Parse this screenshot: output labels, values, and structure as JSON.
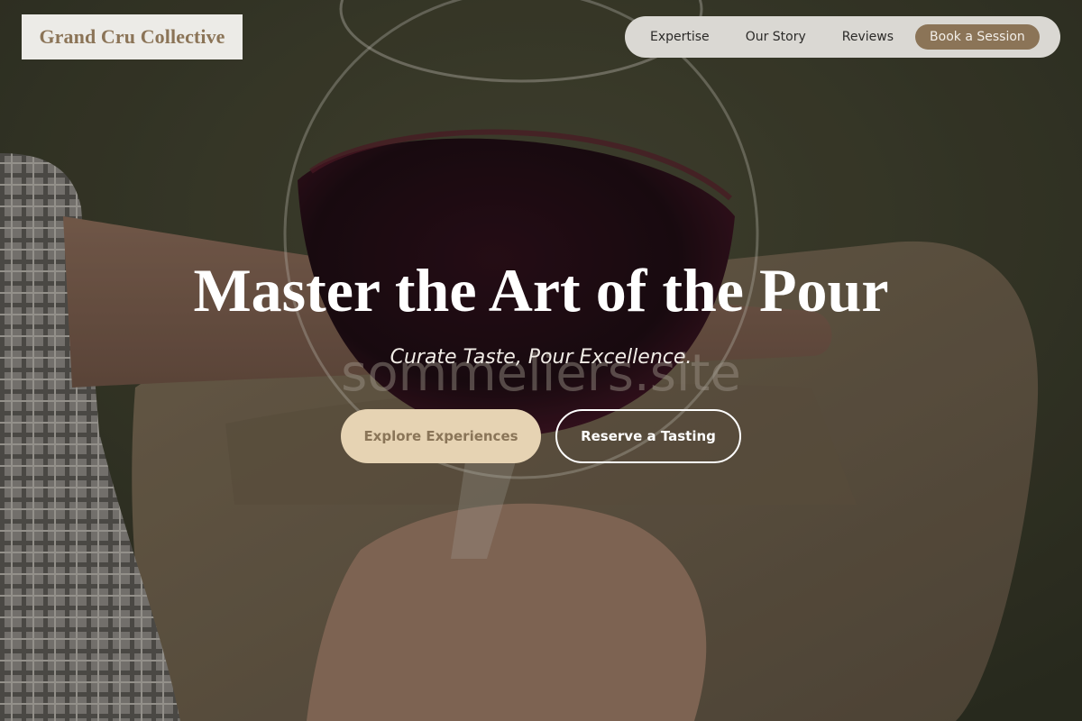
{
  "brand": {
    "name": "Grand Cru Collective"
  },
  "nav": {
    "links": [
      {
        "label": "Expertise"
      },
      {
        "label": "Our Story"
      },
      {
        "label": "Reviews"
      }
    ],
    "cta_label": "Book a Session"
  },
  "hero": {
    "title": "Master the Art of the Pour",
    "subtitle": "Curate Taste, Pour Excellence.",
    "watermark": "sommeliers.site",
    "primary_button": "Explore Experiences",
    "secondary_button": "Reserve a Tasting"
  },
  "colors": {
    "accent": "#8b7457",
    "primary_button_bg": "#e6d3b3",
    "nav_bg": "#dad8d3",
    "logo_bg": "#ecebe7"
  }
}
